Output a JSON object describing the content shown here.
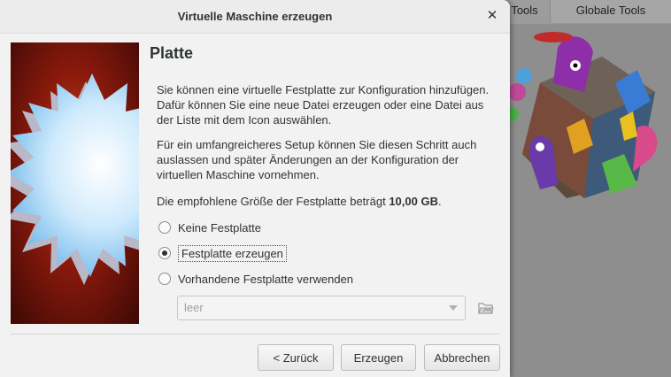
{
  "background_app": {
    "tabs": [
      "Tools",
      "Globale Tools"
    ]
  },
  "dialog": {
    "title": "Virtuelle Maschine erzeugen",
    "close_icon": "close-icon",
    "page_title": "Platte",
    "paragraph1": "Sie können eine virtuelle Festplatte zur Konfiguration hinzufügen. Dafür können Sie eine neue Datei erzeugen oder eine Datei aus der Liste mit dem Icon auswählen.",
    "paragraph2": "Für ein umfangreicheres Setup können Sie diesen Schritt auch auslassen und später Änderungen an der Konfiguration der virtuellen Maschine vornehmen.",
    "recommend_prefix": "Die empfohlene Größe der Festplatte beträgt ",
    "recommend_size": "10,00 GB",
    "recommend_suffix": ".",
    "options": [
      {
        "label": "Keine Festplatte",
        "checked": false
      },
      {
        "label": "Festplatte erzeugen",
        "checked": true
      },
      {
        "label": "Vorhandene Festplatte verwenden",
        "checked": false
      }
    ],
    "disk_select": {
      "value": "leer"
    },
    "folder_icon": "folder-open-icon",
    "buttons": {
      "back": "< Zurück",
      "create": "Erzeugen",
      "cancel": "Abbrechen"
    }
  },
  "colors": {
    "dialog_bg": "#f2f2f2",
    "overlay_bg": "#8e8e8e",
    "side_image_red": "#8b1a0c",
    "star_blue": "#9fd4f4"
  }
}
